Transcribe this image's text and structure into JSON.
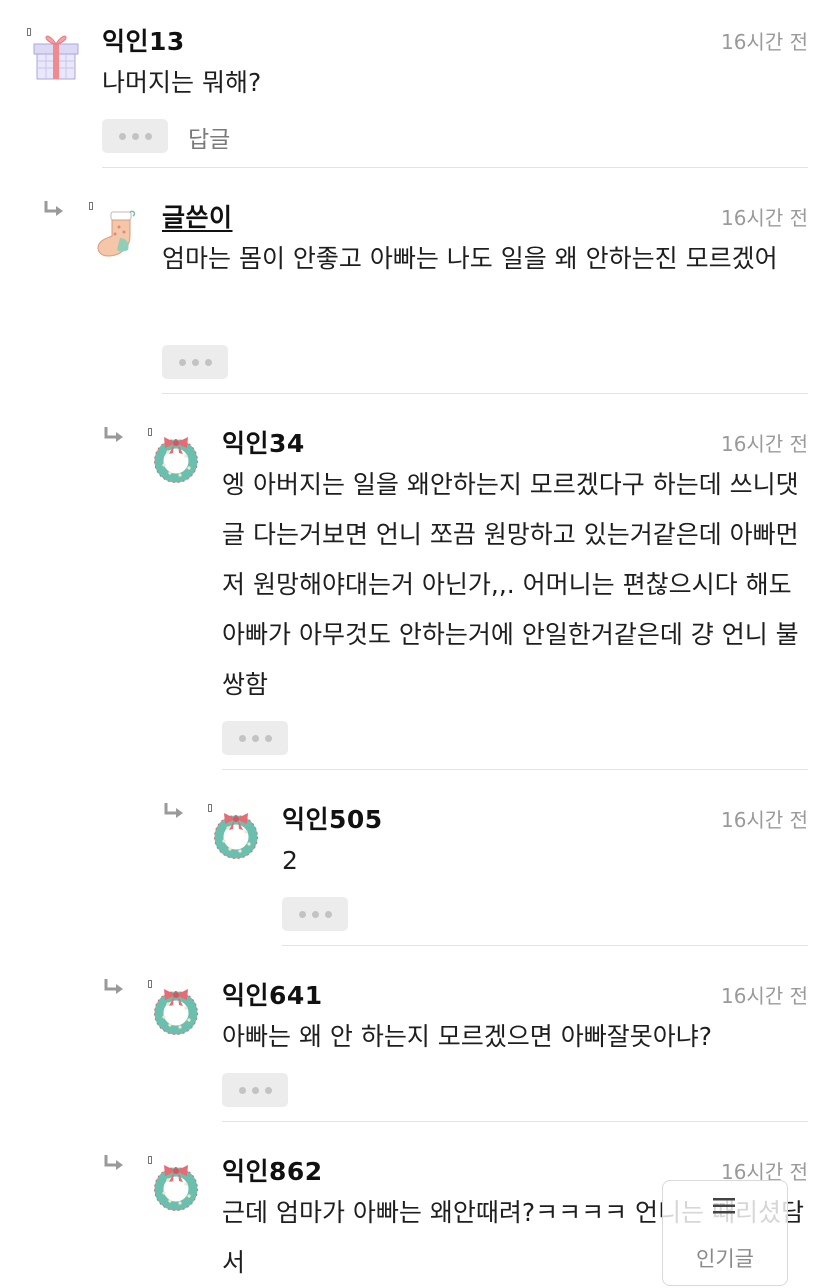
{
  "comments": [
    {
      "author": "익인13",
      "time": "16시간 전",
      "text": "나머지는 뭐해?",
      "reply_label": "답글",
      "avatar": "gift-box-icon"
    },
    {
      "author": "글쓴이",
      "time": "16시간 전",
      "text": "엄마는 몸이 안좋고 아빠는 나도 일을 왜 안하는진 모르겠어",
      "avatar": "christmas-stocking-icon"
    },
    {
      "author": "익인34",
      "time": "16시간 전",
      "text": "엥 아버지는 일을 왜안하는지 모르겠다구 하는데 쓰니댓글 다는거보면 언니 쪼끔 원망하고 있는거같은데 아빠먼저 원망해야대는거 아닌가,,. 어머니는 편찮으시다 해도 아빠가 아무것도 안하는거에 안일한거같은데 걍 언니 불쌍함",
      "avatar": "wreath-icon"
    },
    {
      "author": "익인505",
      "time": "16시간 전",
      "text": "2",
      "avatar": "wreath-icon"
    },
    {
      "author": "익인641",
      "time": "16시간 전",
      "text": "아빠는 왜 안 하는지 모르겠으면 아빠잘못아냐?",
      "avatar": "wreath-icon"
    },
    {
      "author": "익인862",
      "time": "16시간 전",
      "text": "근데 엄마가 아빠는 왜안때려?ㅋㅋㅋㅋ 언니는 때리셨담서",
      "avatar": "wreath-icon"
    }
  ],
  "floating_button": {
    "label": "인기글",
    "icon": "menu-icon"
  }
}
